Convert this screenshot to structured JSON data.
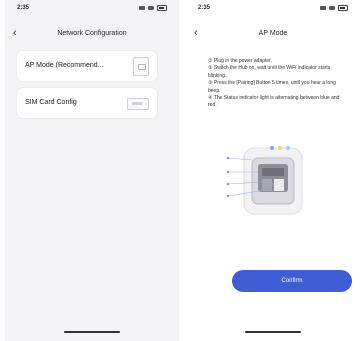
{
  "left_screen": {
    "status": {
      "time": "2:35"
    },
    "nav": {
      "back_icon": "chevron-left-icon",
      "title": "Network Configuration"
    },
    "options": [
      {
        "label": "AP Mode (Recommend...",
        "icon": "hub-device-icon"
      },
      {
        "label": "SIM Card Config",
        "icon": "sim-card-icon"
      }
    ]
  },
  "right_screen": {
    "status": {
      "time": "2:35"
    },
    "nav": {
      "back_icon": "chevron-left-icon",
      "title": "AP Mode"
    },
    "instructions": [
      "① Plug in the power adapter.",
      "② Switch the Hub on, wait until the WiFi indicator starts blinking.",
      "③ Press the [Pairing] Button 5 times, until you hear a long beep.",
      "④ The Status indicator light is alternating between blue and red."
    ],
    "confirm_label": "Confirm"
  },
  "colors": {
    "accent": "#3d5fd3",
    "left_background": "#f3f3f6"
  }
}
